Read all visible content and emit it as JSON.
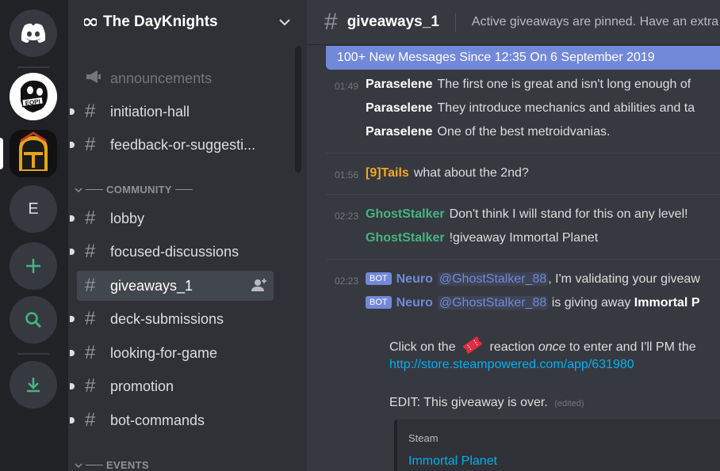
{
  "guild": {
    "name": "The DayKnights"
  },
  "rail": {
    "e_label": "E",
    "eopi_text": "EOPI"
  },
  "channels": {
    "announcements": "announcements",
    "initiation": "initiation-hall",
    "feedback": "feedback-or-suggesti...",
    "community_category": "COMMUNITY",
    "lobby": "lobby",
    "focused": "focused-discussions",
    "giveaways": "giveaways_1",
    "deck": "deck-submissions",
    "lfg": "looking-for-game",
    "promotion": "promotion",
    "botcmds": "bot-commands",
    "events_category": "EVENTS"
  },
  "header": {
    "channel": "giveaways_1",
    "topic": "Active giveaways are pinned. Have an extra"
  },
  "banner": {
    "text": "100+ New Messages Since 12:35 On 6 September 2019"
  },
  "messages": {
    "m1": {
      "time": "01:49",
      "user": "Paraselene",
      "l1": "The first one is great and isn't long enough of",
      "l2": "They introduce mechanics and abilities and ta",
      "l3": "One of the best metroidvanias."
    },
    "m2": {
      "time": "01:56",
      "user": "[9]Tails",
      "text": "what about the 2nd?"
    },
    "m3": {
      "time": "02:23",
      "user": "GhostStalker",
      "l1": "Don't think I will stand for this on any level!",
      "l2": "!giveaway Immortal Planet"
    },
    "m4": {
      "time": "02:23",
      "bot_tag": "BOT",
      "user": "Neuro",
      "mention": "@GhostStalker_88",
      "l1": ", I'm validating your giveaw",
      "l2_pre": "is giving away",
      "l2_bold": "Immortal P",
      "p1_pre": "Click on the",
      "p1_post": "reaction",
      "p1_italic": "once",
      "p1_end": "to enter and I'll PM the",
      "link": "http://store.steampowered.com/app/631980",
      "edit": "EDIT: This giveaway is over.",
      "edited": "(edited)",
      "embed_provider": "Steam",
      "embed_title": "Immortal Planet"
    }
  },
  "colors": {
    "blurple": "#7289da",
    "green": "#43b581",
    "orange": "#f5a623"
  }
}
